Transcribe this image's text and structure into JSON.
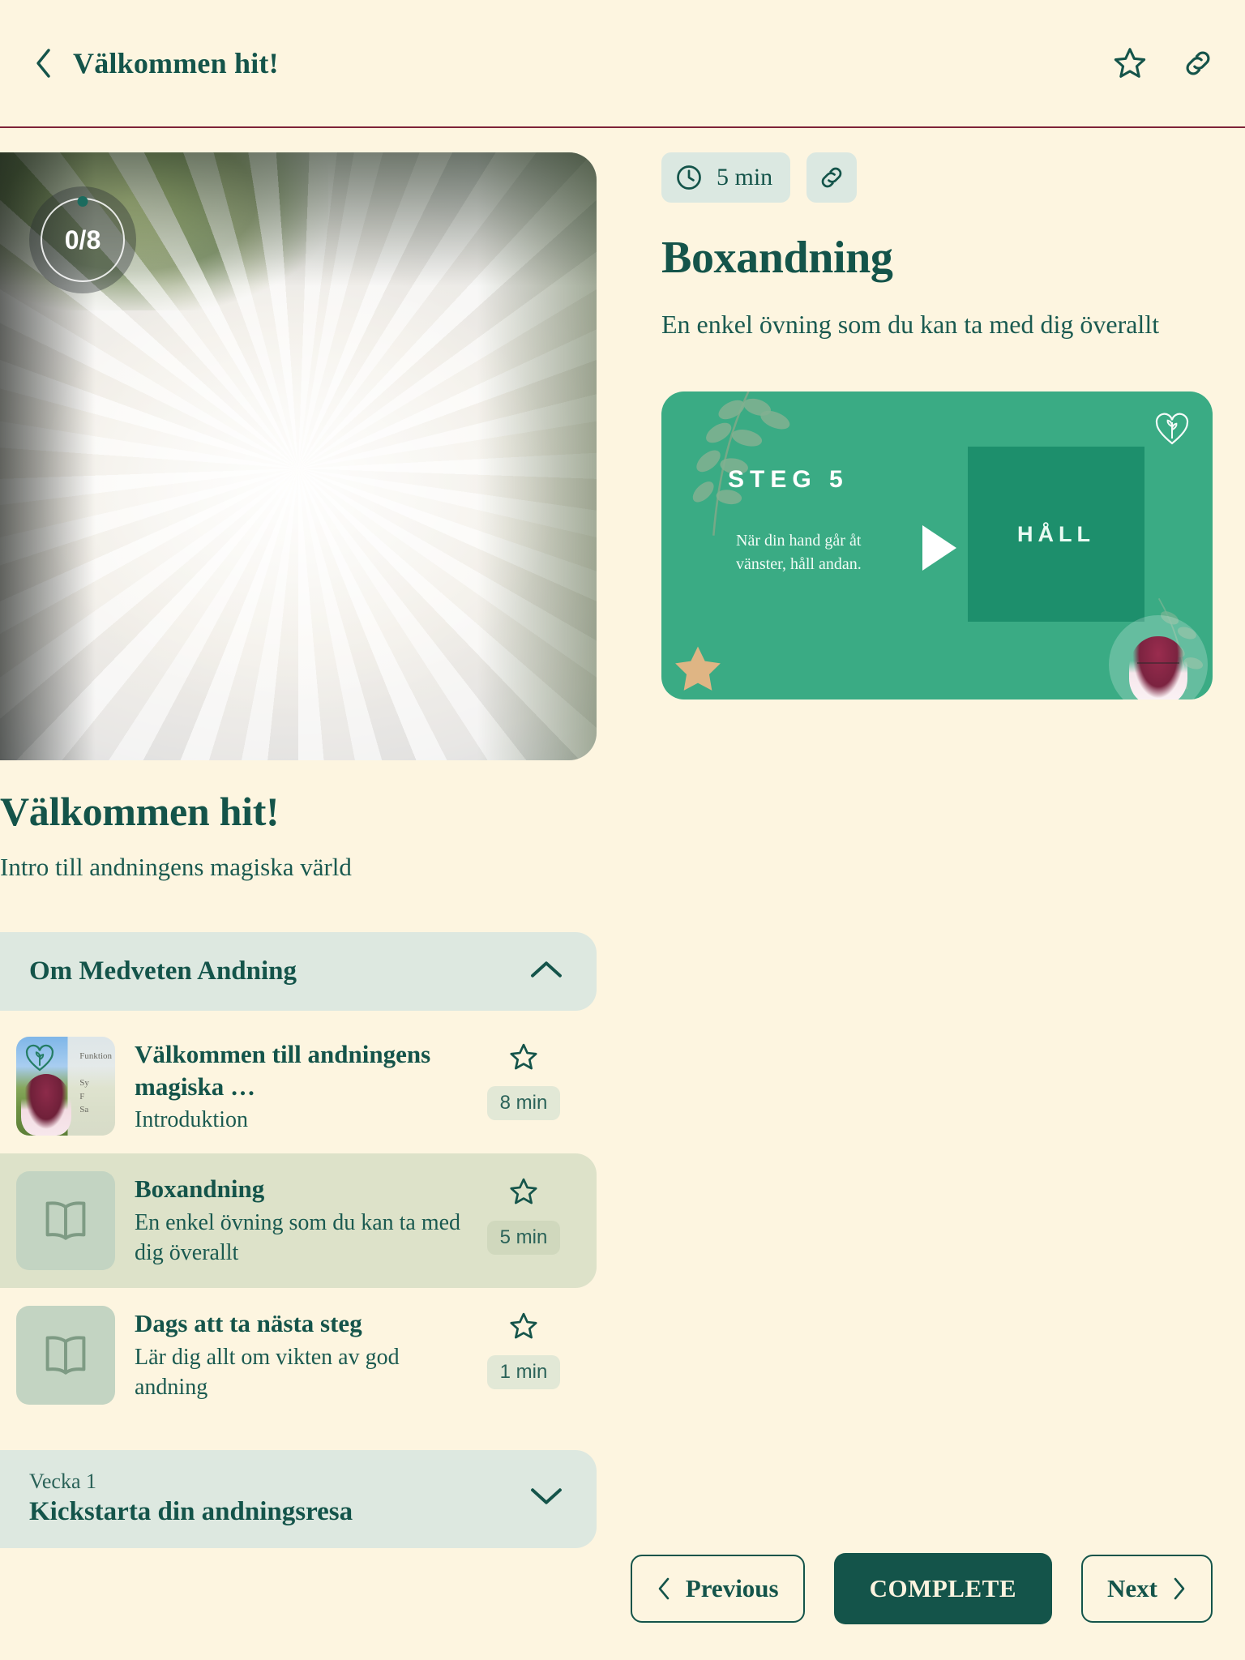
{
  "header": {
    "back_icon": "chevron-left-icon",
    "title": "Välkommen hit!",
    "star_icon": "star-outline-icon",
    "link_icon": "link-icon"
  },
  "left": {
    "progress": {
      "label": "0/8",
      "completed": 0,
      "total": 8
    },
    "course_title": "Välkommen hit!",
    "course_subtitle": "Intro till andningens magiska värld",
    "accordion_open": {
      "title": "Om Medveten Andning",
      "chevron": "chevron-up-icon"
    },
    "lessons": [
      {
        "title": "Välkommen till andningens magiska …",
        "desc": "Introduktion",
        "duration": "8 min",
        "icon": "photo-thumbnail",
        "star_icon": "star-outline-icon",
        "active": false
      },
      {
        "title": "Boxandning",
        "desc": "En enkel övning som du kan ta med dig överallt",
        "duration": "5 min",
        "icon": "book-icon",
        "star_icon": "star-outline-icon",
        "active": true
      },
      {
        "title": "Dags att ta nästa steg",
        "desc": "Lär dig allt om vikten av god andning",
        "duration": "1 min",
        "icon": "book-icon",
        "star_icon": "star-outline-icon",
        "active": false
      }
    ],
    "accordion_closed": {
      "week": "Vecka 1",
      "title": "Kickstarta din andningsresa",
      "chevron": "chevron-down-icon"
    }
  },
  "right": {
    "duration_chip": {
      "icon": "clock-icon",
      "label": "5 min"
    },
    "link_chip": {
      "icon": "link-icon"
    },
    "title": "Boxandning",
    "description": "En enkel övning som du kan ta med dig överallt",
    "video_card": {
      "step_label": "STEG 5",
      "instruction": "När din hand går åt vänster, håll andan.",
      "box_label": "HÅLL",
      "play_icon": "play-icon",
      "logo_icon": "heart-leaf-logo-icon",
      "star_icon": "star-decoration-icon",
      "avatar": "presenter-avatar",
      "bg_color": "#3aab84",
      "box_color": "#1d8f6c"
    }
  },
  "bottom_nav": {
    "previous": {
      "label": "Previous",
      "icon": "chevron-left-icon"
    },
    "complete": {
      "label": "COMPLETE"
    },
    "next": {
      "label": "Next",
      "icon": "chevron-right-icon"
    }
  },
  "theme": {
    "bg": "#fdf5e0",
    "primary": "#14544a",
    "accent_rule": "#7e2338",
    "panel": "#dde8e0",
    "active_row": "#dde2c9"
  }
}
